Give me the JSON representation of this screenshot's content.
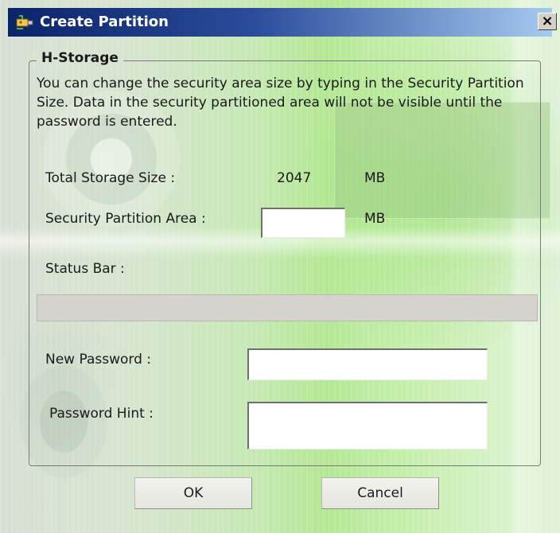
{
  "window": {
    "title": "Create Partition",
    "close_symbol": "×",
    "title_icon": "usb-drive-icon"
  },
  "group": {
    "legend": "H-Storage",
    "description": "You can change the security area size by typing in the Security Partition Size. Data in the security  partitioned area will not be visible until the password is entered."
  },
  "fields": {
    "total_storage_label": "Total Storage Size :",
    "total_storage_value": "2047",
    "total_storage_unit": "MB",
    "security_partition_label": "Security Partition Area :",
    "security_partition_value": "",
    "security_partition_unit": "MB",
    "status_bar_label": "Status Bar :",
    "status_bar_progress": 0,
    "new_password_label": "New Password :",
    "new_password_value": "",
    "password_hint_label": "Password Hint :",
    "password_hint_value": ""
  },
  "buttons": {
    "ok": "OK",
    "cancel": "Cancel"
  },
  "colors": {
    "titlebar_start": "#0a246a",
    "titlebar_end": "#a6caf0",
    "background_accent": "#b4e894"
  }
}
